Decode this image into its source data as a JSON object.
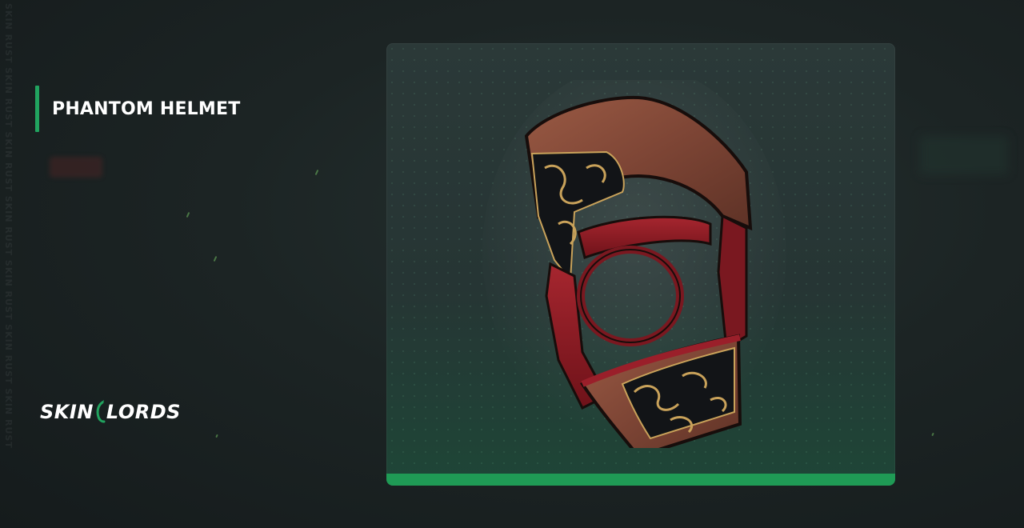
{
  "item": {
    "name": "PHANTOM HELMET"
  },
  "brand": {
    "logo_text_left": "SKIN",
    "logo_text_right": "LORDS",
    "accent_color": "#21a35f"
  },
  "watermark": {
    "text": "SKIN RUST SKIN RUST SKIN RUST SKIN RUST SKIN RUST SKIN RUST SKIN RUST"
  },
  "card": {
    "image_subject": "phantom-helmet-render",
    "bar_color": "#1f9a55"
  }
}
